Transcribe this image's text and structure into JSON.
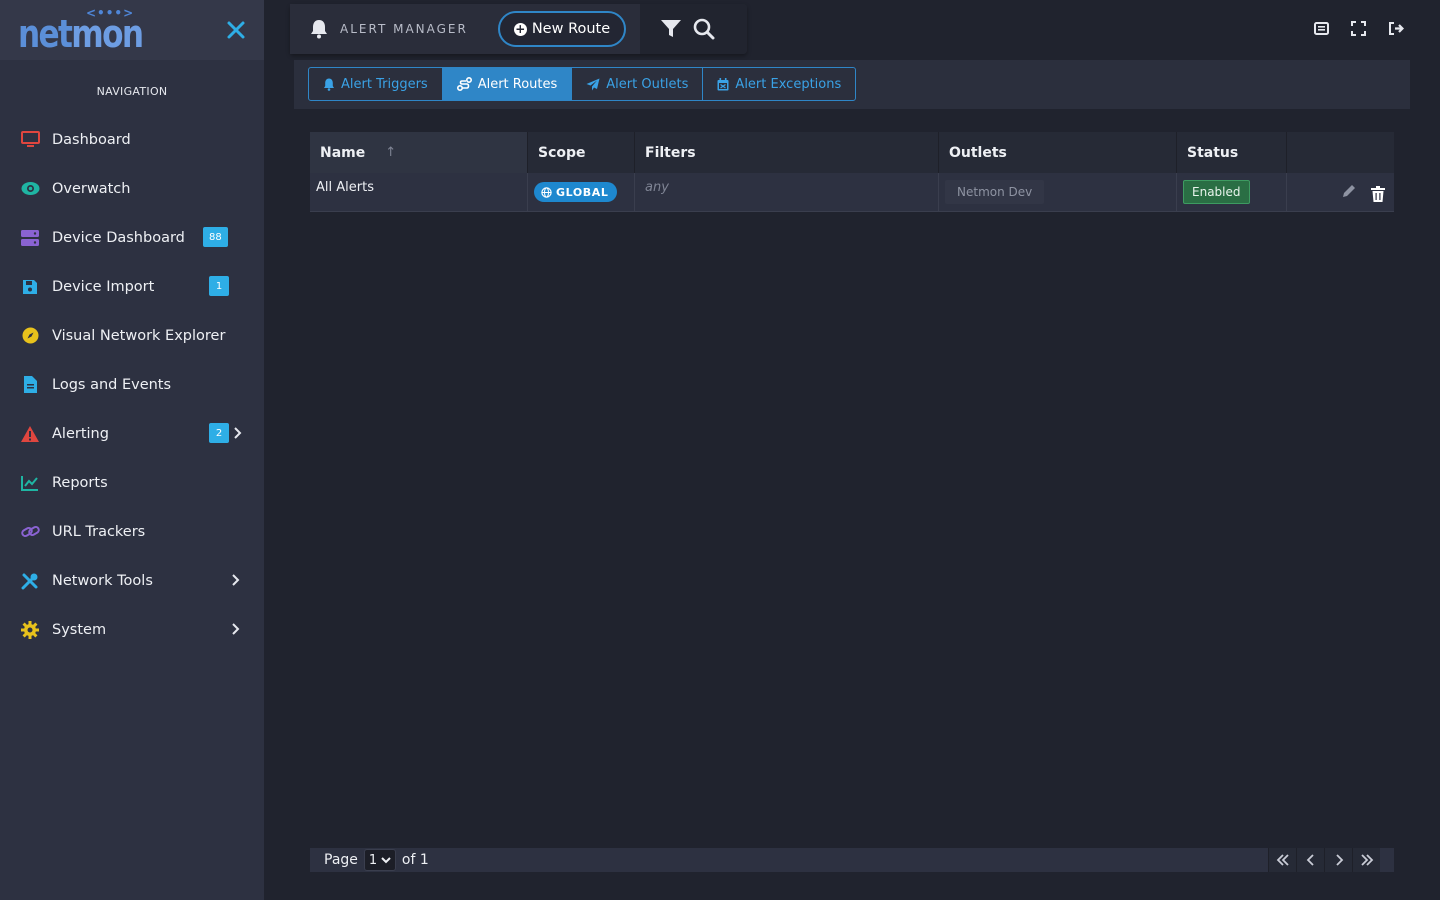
{
  "sidebar": {
    "logo": {
      "text_net": "net",
      "text_mon": "mon",
      "dots": "<•••>"
    },
    "heading": "NAVIGATION",
    "items": [
      {
        "label": "Dashboard",
        "icon": "monitor-icon",
        "color": "#e0463f"
      },
      {
        "label": "Overwatch",
        "icon": "eye-icon",
        "color": "#1fb5a3"
      },
      {
        "label": "Device Dashboard",
        "icon": "server-icon",
        "color": "#8a63d2",
        "badge": "88"
      },
      {
        "label": "Device Import",
        "icon": "save-icon",
        "color": "#2eaee6",
        "badge": "1"
      },
      {
        "label": "Visual Network Explorer",
        "icon": "compass-icon",
        "color": "#e8c21c"
      },
      {
        "label": "Logs and Events",
        "icon": "file-icon",
        "color": "#2eaee6"
      },
      {
        "label": "Alerting",
        "icon": "warning-icon",
        "color": "#e0463f",
        "badge": "2"
      },
      {
        "label": "Reports",
        "icon": "line-chart-icon",
        "color": "#1fb5a3"
      },
      {
        "label": "URL Trackers",
        "icon": "link-icon",
        "color": "#8a63d2"
      },
      {
        "label": "Network Tools",
        "icon": "tools-icon",
        "color": "#2eaee6"
      },
      {
        "label": "System",
        "icon": "gear-icon",
        "color": "#e8c21c"
      }
    ]
  },
  "topbar": {
    "title": "ALERT MANAGER",
    "new_route_label": "New Route"
  },
  "tabs": [
    {
      "label": "Alert Triggers",
      "icon": "bell-icon",
      "active": false
    },
    {
      "label": "Alert Routes",
      "icon": "route-icon",
      "active": true
    },
    {
      "label": "Alert Outlets",
      "icon": "send-icon",
      "active": false
    },
    {
      "label": "Alert Exceptions",
      "icon": "calendar-icon",
      "active": false
    }
  ],
  "table": {
    "columns": [
      "Name",
      "Scope",
      "Filters",
      "Outlets",
      "Status"
    ],
    "sort_indicator": "↑",
    "rows": [
      {
        "name": "All Alerts",
        "scope": "GLOBAL",
        "filters": "any",
        "outlets": "Netmon Dev",
        "status": "Enabled"
      }
    ]
  },
  "pager": {
    "page_label": "Page",
    "current_page": "1",
    "of_label": "of 1"
  },
  "colors": {
    "accent": "#2f86c7",
    "status_enabled": "#2a6e44"
  }
}
